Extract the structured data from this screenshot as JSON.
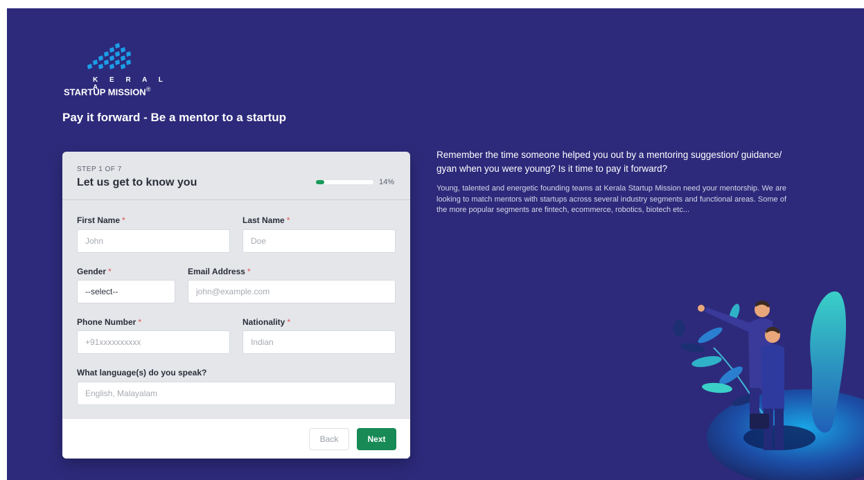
{
  "brand": {
    "line1": "K E R A L A",
    "line2": "STARTUP MISSION",
    "mark": "®"
  },
  "headline": "Pay it forward - Be a mentor to a startup",
  "form": {
    "step": "STEP 1 OF 7",
    "title": "Let us get to know you",
    "progress_percent": 14,
    "progress_text": "14%",
    "fields": {
      "first_name": {
        "label": "First Name",
        "required": "*",
        "placeholder": "John"
      },
      "last_name": {
        "label": "Last Name",
        "required": "*",
        "placeholder": "Doe"
      },
      "gender": {
        "label": "Gender",
        "required": "*",
        "value": "--select--"
      },
      "email": {
        "label": "Email Address",
        "required": "*",
        "placeholder": "john@example.com"
      },
      "phone": {
        "label": "Phone Number",
        "required": "*",
        "placeholder": "+91xxxxxxxxxx"
      },
      "nationality": {
        "label": "Nationality",
        "required": "*",
        "placeholder": "Indian"
      },
      "languages": {
        "label": "What language(s) do you speak?",
        "placeholder": "English, Malayalam"
      }
    },
    "buttons": {
      "back": "Back",
      "next": "Next"
    }
  },
  "info": {
    "title": "Remember the time someone helped you out by a mentoring suggestion/ guidance/ gyan when you were young? Is it time to pay it forward?",
    "body": "Young, talented and energetic founding teams at Kerala Startup Mission need your mentorship. We are looking to match mentors with startups across several industry segments and functional areas. Some of the more popular segments are fintech, ecommerce, robotics, biotech etc..."
  },
  "colors": {
    "background": "#2d2a7b",
    "accent_green": "#178a55",
    "required": "#e0524a",
    "logo_blue": "#1c9ee8"
  }
}
